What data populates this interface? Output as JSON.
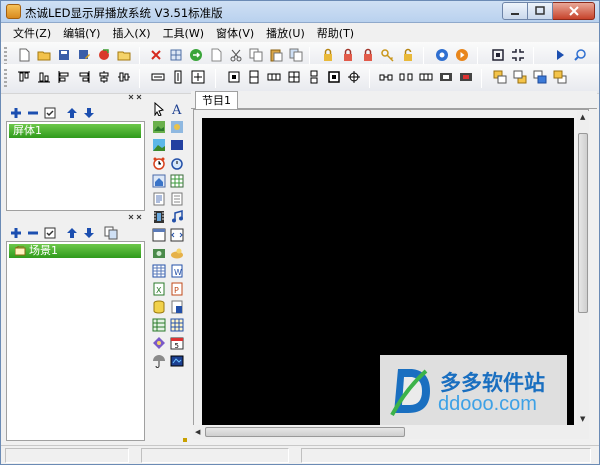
{
  "window": {
    "title": "杰诚LED显示屏播放系统 V3.51标准版"
  },
  "menu": {
    "items": [
      "文件(Z)",
      "编辑(Y)",
      "插入(X)",
      "工具(W)",
      "窗体(V)",
      "播放(U)",
      "帮助(T)"
    ]
  },
  "left_panel": {
    "screen_item": "屏体1",
    "scene_item": "场景1"
  },
  "editor": {
    "tab_label": "节目1"
  },
  "watermark": {
    "title": "多多软件站",
    "url": "ddooo.com"
  },
  "colors": {
    "selection_green": "#3aa622",
    "canvas_black": "#000000",
    "watermark_blue": "#1a6fc0"
  }
}
